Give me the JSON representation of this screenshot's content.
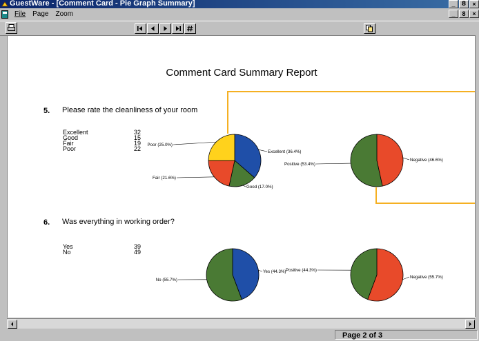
{
  "window": {
    "title": "GuestWare - [Comment Card - Pie Graph Summary]",
    "buttons": [
      "_",
      "8",
      "×"
    ]
  },
  "menu": {
    "items": [
      "File",
      "Page",
      "Zoom"
    ],
    "doc_buttons": [
      "_",
      "8",
      "×"
    ]
  },
  "toolbar": {
    "nav_buttons": [
      "first",
      "previous",
      "next",
      "last",
      "go-to-page"
    ]
  },
  "report": {
    "title": "Comment Card Summary Report",
    "questions": [
      {
        "number": "5.",
        "text": "Please rate the cleanliness of your room",
        "responses": [
          {
            "label": "Excellent",
            "count": "32"
          },
          {
            "label": "Good",
            "count": "15"
          },
          {
            "label": "Fair",
            "count": "19"
          },
          {
            "label": "Poor",
            "count": "22"
          }
        ]
      },
      {
        "number": "6.",
        "text": "Was everything in working order?",
        "responses": [
          {
            "label": "Yes",
            "count": "39"
          },
          {
            "label": "No",
            "count": "49"
          }
        ]
      }
    ]
  },
  "colors": {
    "blue": "#1f4fa8",
    "green": "#4a7a34",
    "red": "#e84a2a",
    "yellow": "#ffd21c",
    "callout": "#f5b022"
  },
  "chart_data": [
    {
      "type": "pie",
      "slices": [
        {
          "label": "Excellent (36.4%)",
          "value": 36.4,
          "color": "#1f4fa8"
        },
        {
          "label": "Good (17.0%)",
          "value": 17.0,
          "color": "#4a7a34"
        },
        {
          "label": "Fair (21.6%)",
          "value": 21.6,
          "color": "#e84a2a"
        },
        {
          "label": "Poor (25.0%)",
          "value": 25.0,
          "color": "#ffd21c"
        }
      ]
    },
    {
      "type": "pie",
      "slices": [
        {
          "label": "Negative (46.6%)",
          "value": 46.6,
          "color": "#e84a2a"
        },
        {
          "label": "Positive (53.4%)",
          "value": 53.4,
          "color": "#4a7a34"
        }
      ]
    },
    {
      "type": "pie",
      "slices": [
        {
          "label": "Yes (44.3%)",
          "value": 44.3,
          "color": "#1f4fa8"
        },
        {
          "label": "No (55.7%)",
          "value": 55.7,
          "color": "#4a7a34"
        }
      ]
    },
    {
      "type": "pie",
      "slices": [
        {
          "label": "Negative (55.7%)",
          "value": 55.7,
          "color": "#e84a2a"
        },
        {
          "label": "Positive (44.3%)",
          "value": 44.3,
          "color": "#4a7a34"
        }
      ]
    }
  ],
  "status": {
    "page": "Page 2 of 3"
  }
}
